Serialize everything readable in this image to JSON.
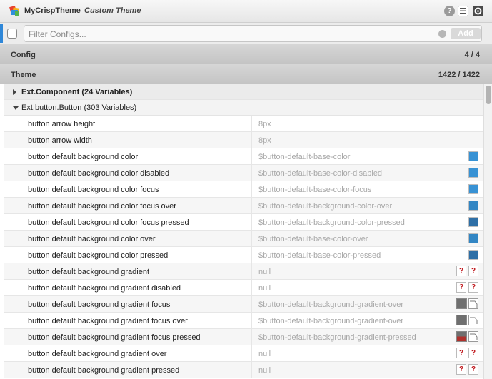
{
  "titlebar": {
    "app_name": "MyCrispTheme",
    "theme_name": "Custom Theme",
    "help_icon": "?"
  },
  "filter": {
    "placeholder": "Filter Configs...",
    "add_label": "Add"
  },
  "sections": {
    "config": {
      "label": "Config",
      "count": "4 / 4"
    },
    "theme": {
      "label": "Theme",
      "count": "1422 / 1422"
    }
  },
  "groups": [
    {
      "label": "Ext.Component (24 Variables)",
      "expanded": false
    },
    {
      "label": "Ext.button.Button (303 Variables)",
      "expanded": true
    }
  ],
  "variables": [
    {
      "name": "button arrow height",
      "value": "8px",
      "preview": "none"
    },
    {
      "name": "button arrow width",
      "value": "8px",
      "preview": "none"
    },
    {
      "name": "button default background color",
      "value": "$button-default-base-color",
      "preview": "color",
      "color": "#3892d4"
    },
    {
      "name": "button default background color disabled",
      "value": "$button-default-base-color-disabled",
      "preview": "color",
      "color": "#3892d4"
    },
    {
      "name": "button default background color focus",
      "value": "$button-default-base-color-focus",
      "preview": "color",
      "color": "#3892d4"
    },
    {
      "name": "button default background color focus over",
      "value": "$button-default-background-color-over",
      "preview": "color",
      "color": "#3286c4"
    },
    {
      "name": "button default background color focus pressed",
      "value": "$button-default-background-color-pressed",
      "preview": "color",
      "color": "#2e6fa6"
    },
    {
      "name": "button default background color over",
      "value": "$button-default-base-color-over",
      "preview": "color",
      "color": "#3286c4"
    },
    {
      "name": "button default background color pressed",
      "value": "$button-default-base-color-pressed",
      "preview": "color",
      "color": "#2e6fa6"
    },
    {
      "name": "button default background gradient",
      "value": "null",
      "preview": "unknown"
    },
    {
      "name": "button default background gradient disabled",
      "value": "null",
      "preview": "unknown"
    },
    {
      "name": "button default background gradient focus",
      "value": "$button-default-background-gradient-over",
      "preview": "gradient",
      "color": "#6f6f6f"
    },
    {
      "name": "button default background gradient focus over",
      "value": "$button-default-background-gradient-over",
      "preview": "gradient",
      "color": "#6f6f6f"
    },
    {
      "name": "button default background gradient focus pressed",
      "value": "$button-default-background-gradient-pressed",
      "preview": "gradient-pressed",
      "color": "#b0312c"
    },
    {
      "name": "button default background gradient over",
      "value": "null",
      "preview": "unknown"
    },
    {
      "name": "button default background gradient pressed",
      "value": "null",
      "preview": "unknown"
    }
  ],
  "colors": {
    "accent": "#2f87d8",
    "unknown_mark": "#c0151a"
  }
}
